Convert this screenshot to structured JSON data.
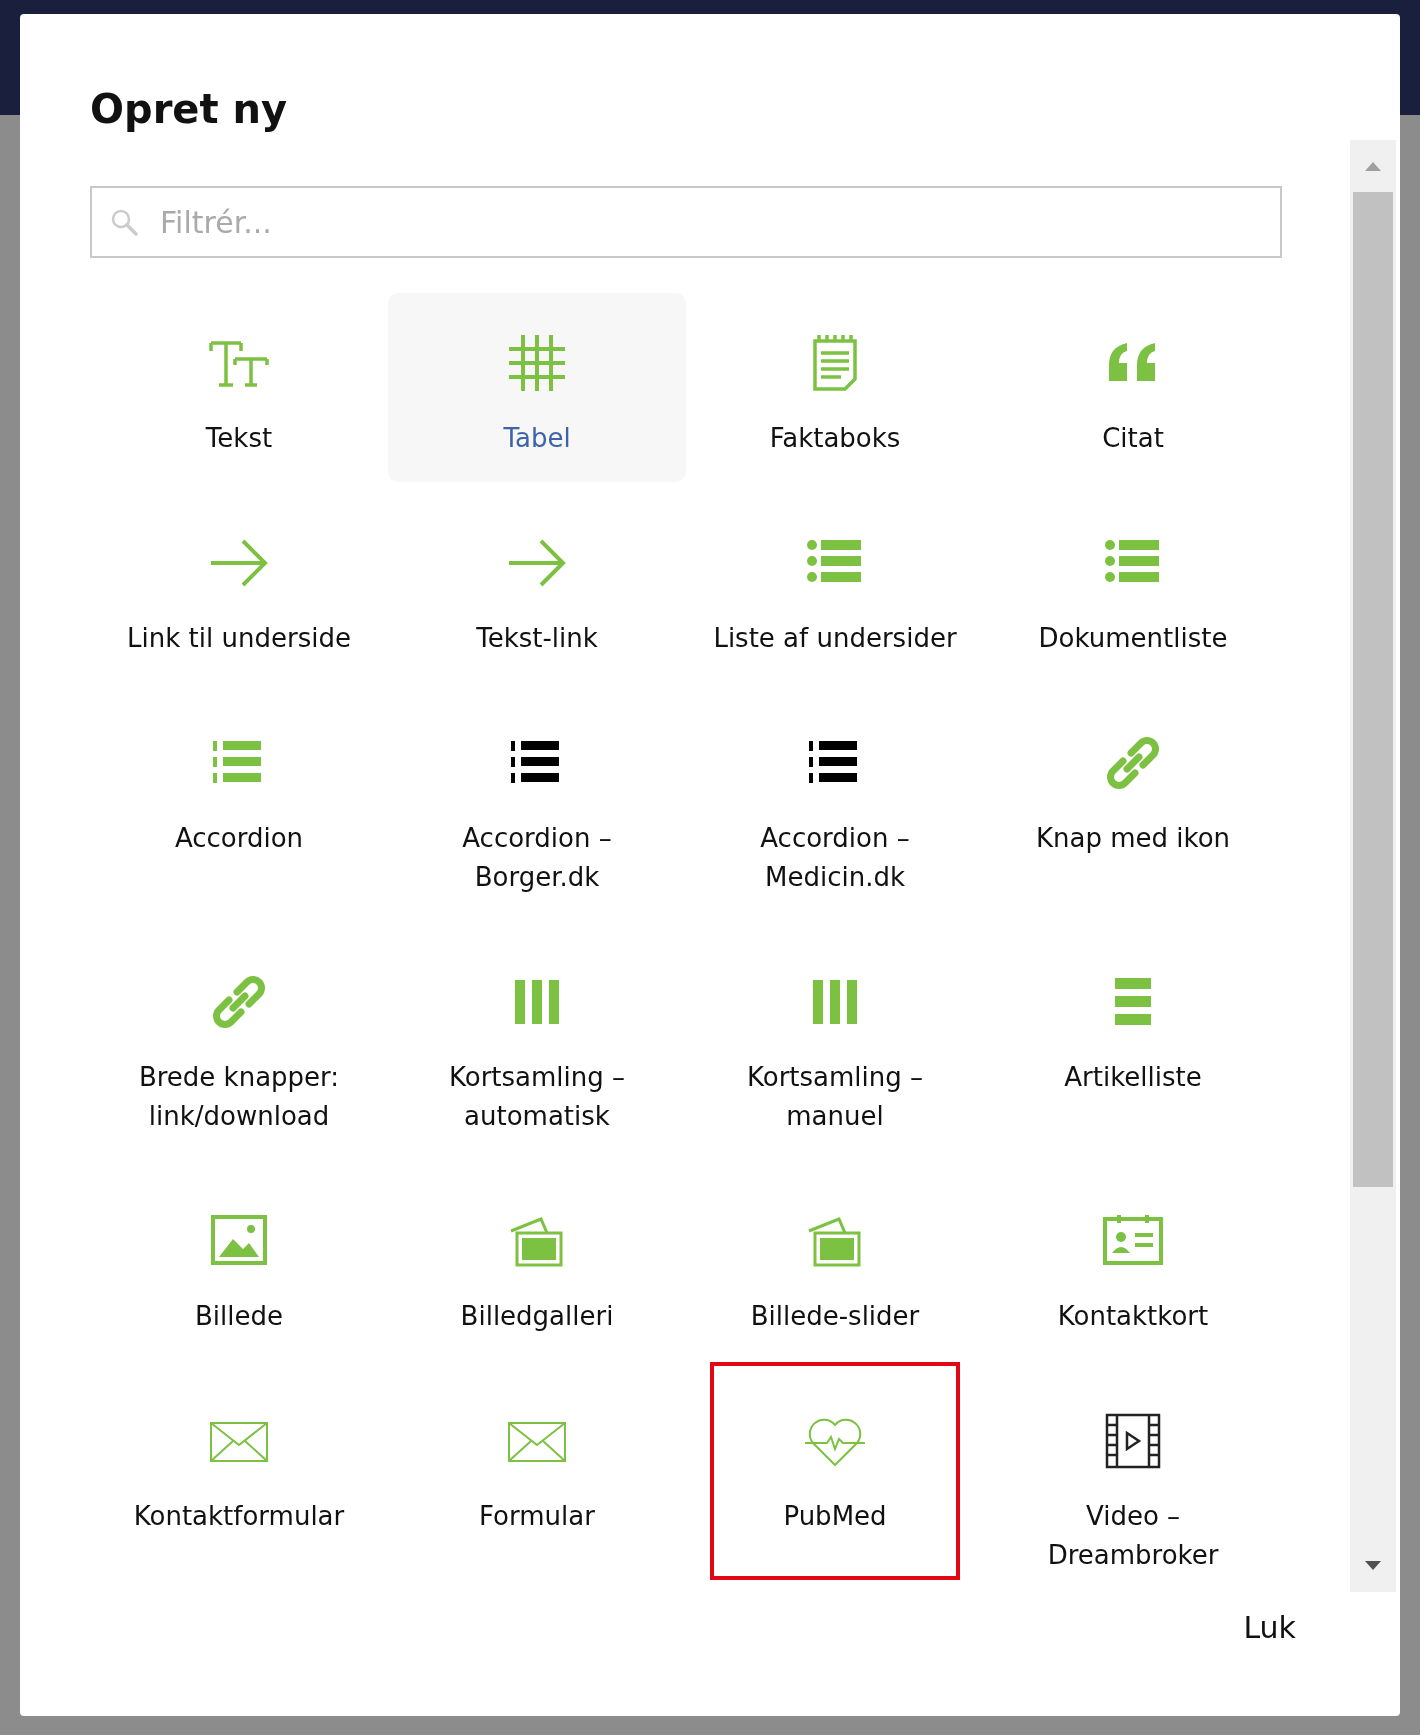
{
  "dialog": {
    "title": "Opret ny",
    "search": {
      "placeholder": "Filtrér..."
    },
    "items": [
      {
        "label": "Tekst",
        "selected": false,
        "outlined": false
      },
      {
        "label": "Tabel",
        "selected": true,
        "outlined": false
      },
      {
        "label": "Faktaboks",
        "selected": false,
        "outlined": false
      },
      {
        "label": "Citat",
        "selected": false,
        "outlined": false
      },
      {
        "label": "Link til underside",
        "selected": false,
        "outlined": false
      },
      {
        "label": "Tekst-link",
        "selected": false,
        "outlined": false
      },
      {
        "label": "Liste af undersider",
        "selected": false,
        "outlined": false
      },
      {
        "label": "Dokumentliste",
        "selected": false,
        "outlined": false
      },
      {
        "label": "Accordion",
        "selected": false,
        "outlined": false
      },
      {
        "label": "Accordion – Borger.dk",
        "selected": false,
        "outlined": false
      },
      {
        "label": "Accordion – Medicin.dk",
        "selected": false,
        "outlined": false
      },
      {
        "label": "Knap med ikon",
        "selected": false,
        "outlined": false
      },
      {
        "label": "Brede knapper: link/download",
        "selected": false,
        "outlined": false
      },
      {
        "label": "Kortsamling – automatisk",
        "selected": false,
        "outlined": false
      },
      {
        "label": "Kortsamling – manuel",
        "selected": false,
        "outlined": false
      },
      {
        "label": "Artikelliste",
        "selected": false,
        "outlined": false
      },
      {
        "label": "Billede",
        "selected": false,
        "outlined": false
      },
      {
        "label": "Billedgalleri",
        "selected": false,
        "outlined": false
      },
      {
        "label": "Billede-slider",
        "selected": false,
        "outlined": false
      },
      {
        "label": "Kontaktkort",
        "selected": false,
        "outlined": false
      },
      {
        "label": "Kontaktformular",
        "selected": false,
        "outlined": false
      },
      {
        "label": "Formular",
        "selected": false,
        "outlined": false
      },
      {
        "label": "PubMed",
        "selected": false,
        "outlined": true
      },
      {
        "label": "Video – Dreambroker",
        "selected": false,
        "outlined": false
      }
    ],
    "close_button": "Luk"
  }
}
